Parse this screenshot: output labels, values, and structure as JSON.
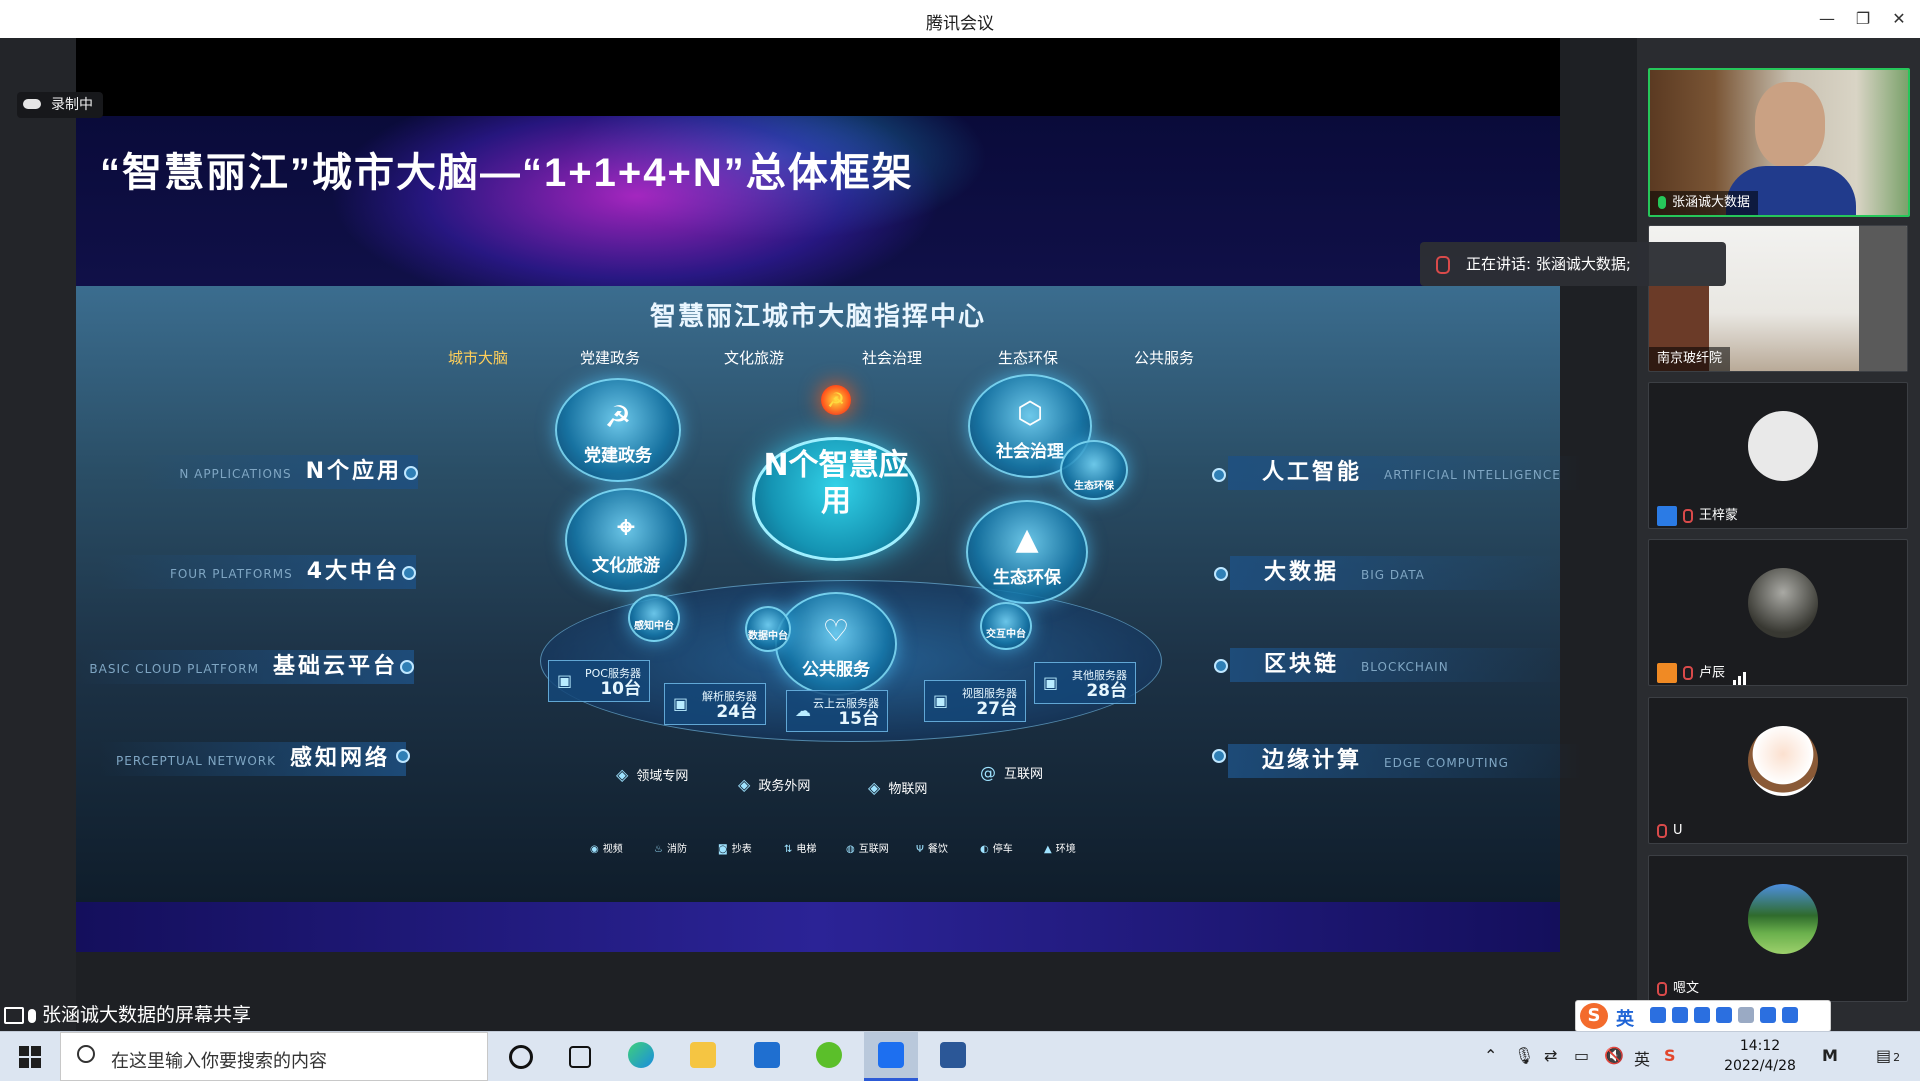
{
  "window": {
    "title": "腾讯会议"
  },
  "recording": {
    "label": "录制中"
  },
  "slide": {
    "title": "“智慧丽江”城市大脑—“1+1+4+N”总体框架",
    "center_title": "智慧丽江城市大脑指挥中心",
    "categories": [
      "城市大脑",
      "党建政务",
      "文化旅游",
      "社会治理",
      "生态环保",
      "公共服务"
    ],
    "left_items": [
      {
        "en": "N APPLICATIONS",
        "cn": "N个应用"
      },
      {
        "en": "FOUR PLATFORMS",
        "cn": "4大中台"
      },
      {
        "en": "BASIC CLOUD PLATFORM",
        "cn": "基础云平台"
      },
      {
        "en": "PERCEPTUAL NETWORK",
        "cn": "感知网络"
      }
    ],
    "right_items": [
      {
        "cn": "人工智能",
        "en": "ARTIFICIAL INTELLIGENCE"
      },
      {
        "cn": "大数据",
        "en": "BIG DATA"
      },
      {
        "cn": "区块链",
        "en": "BLOCKCHAIN"
      },
      {
        "cn": "边缘计算",
        "en": "EDGE COMPUTING"
      }
    ],
    "core": "N个智慧应用",
    "spheres": {
      "dangjian": "党建政务",
      "wenhua": "文化旅游",
      "shehui": "社会治理",
      "shengtai": "生态环保",
      "gonggong": "公共服务",
      "shengtai_small": "生态环保",
      "ganzhi": "感知中台",
      "shuju": "数据中台",
      "jiaohu": "交互中台"
    },
    "servers": [
      {
        "name": "POC服务器",
        "count": "10台"
      },
      {
        "name": "解析服务器",
        "count": "24台"
      },
      {
        "name": "云上云服务器",
        "count": "15台"
      },
      {
        "name": "视图服务器",
        "count": "27台"
      },
      {
        "name": "其他服务器",
        "count": "28台"
      }
    ],
    "networks": [
      "领域专网",
      "政务外网",
      "物联网",
      "互联网"
    ],
    "apps": [
      "视频",
      "消防",
      "抄表",
      "电梯",
      "互联网",
      "餐饮",
      "停车",
      "环境"
    ]
  },
  "share_caption": "张涵诚大数据的屏幕共享",
  "speaking": "正在讲话: 张涵诚大数据;",
  "participants": [
    {
      "name": "张涵诚大数据",
      "mic": "on",
      "kind": "video"
    },
    {
      "name": "南京玻纤院",
      "mic": "none",
      "kind": "video"
    },
    {
      "name": "王梓蒙",
      "mic": "off",
      "kind": "avatar"
    },
    {
      "name": "卢辰",
      "mic": "off",
      "kind": "avatar"
    },
    {
      "name": "U",
      "mic": "off",
      "kind": "avatar"
    },
    {
      "name": "嗯文",
      "mic": "off",
      "kind": "avatar"
    }
  ],
  "ime": {
    "mode": "英"
  },
  "taskbar": {
    "search_placeholder": "在这里输入你要搜索的内容",
    "time": "14:12",
    "date": "2022/4/28",
    "notifications": "2"
  },
  "colors": {
    "active_speaker_border": "#26c75a",
    "muted_red": "#d94a4a",
    "taskbar_accent": "#2c5ad6"
  }
}
